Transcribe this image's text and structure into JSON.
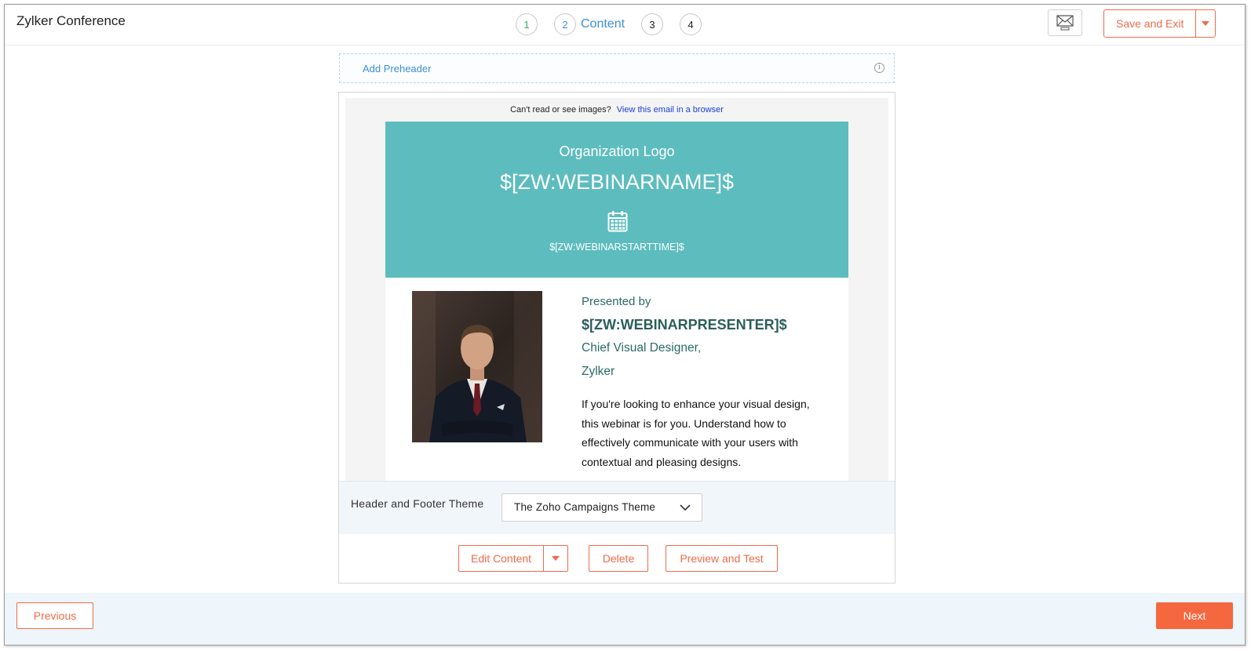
{
  "app": {
    "title": "Zylker Conference"
  },
  "steps": [
    {
      "number": "1",
      "state": "done"
    },
    {
      "number": "2",
      "label": "Content",
      "state": "active"
    },
    {
      "number": "3",
      "state": "pending"
    },
    {
      "number": "4",
      "state": "pending"
    }
  ],
  "toolbar": {
    "preview_icon": "email-preview-icon",
    "save_exit_label": "Save and Exit"
  },
  "preheader": {
    "label": "Add Preheader",
    "icon": "info-icon"
  },
  "email": {
    "view_browser_prefix": "Can't read or see images?",
    "view_browser_link": "View this email in a browser",
    "hero": {
      "org_logo": "Organization Logo",
      "webinar_name": "$[ZW:WEBINARNAME]$",
      "calendar_icon": "calendar-icon",
      "start_time": "$[ZW:WEBINARSTARTTIME]$",
      "background": "#5dbcbe"
    },
    "presenter": {
      "presented_by": "Presented by",
      "name": "$[ZW:WEBINARPRESENTER]$",
      "title": "Chief Visual Designer,",
      "org": "Zylker",
      "description": "If you're looking to enhance your visual design, this webinar is for you. Understand how to effectively communicate with your users with contextual and pleasing designs."
    }
  },
  "theme": {
    "label": "Header and Footer Theme",
    "selected": "The Zoho Campaigns Theme"
  },
  "actions": {
    "edit_content": "Edit Content",
    "delete": "Delete",
    "preview_test": "Preview and Test"
  },
  "footer": {
    "previous": "Previous",
    "next": "Next"
  },
  "colors": {
    "accent": "#f06b4a",
    "next_button": "#f5683f",
    "step_active": "#3d8fd6",
    "step_done": "#36a66b",
    "presenter_text": "#2b6b68"
  }
}
